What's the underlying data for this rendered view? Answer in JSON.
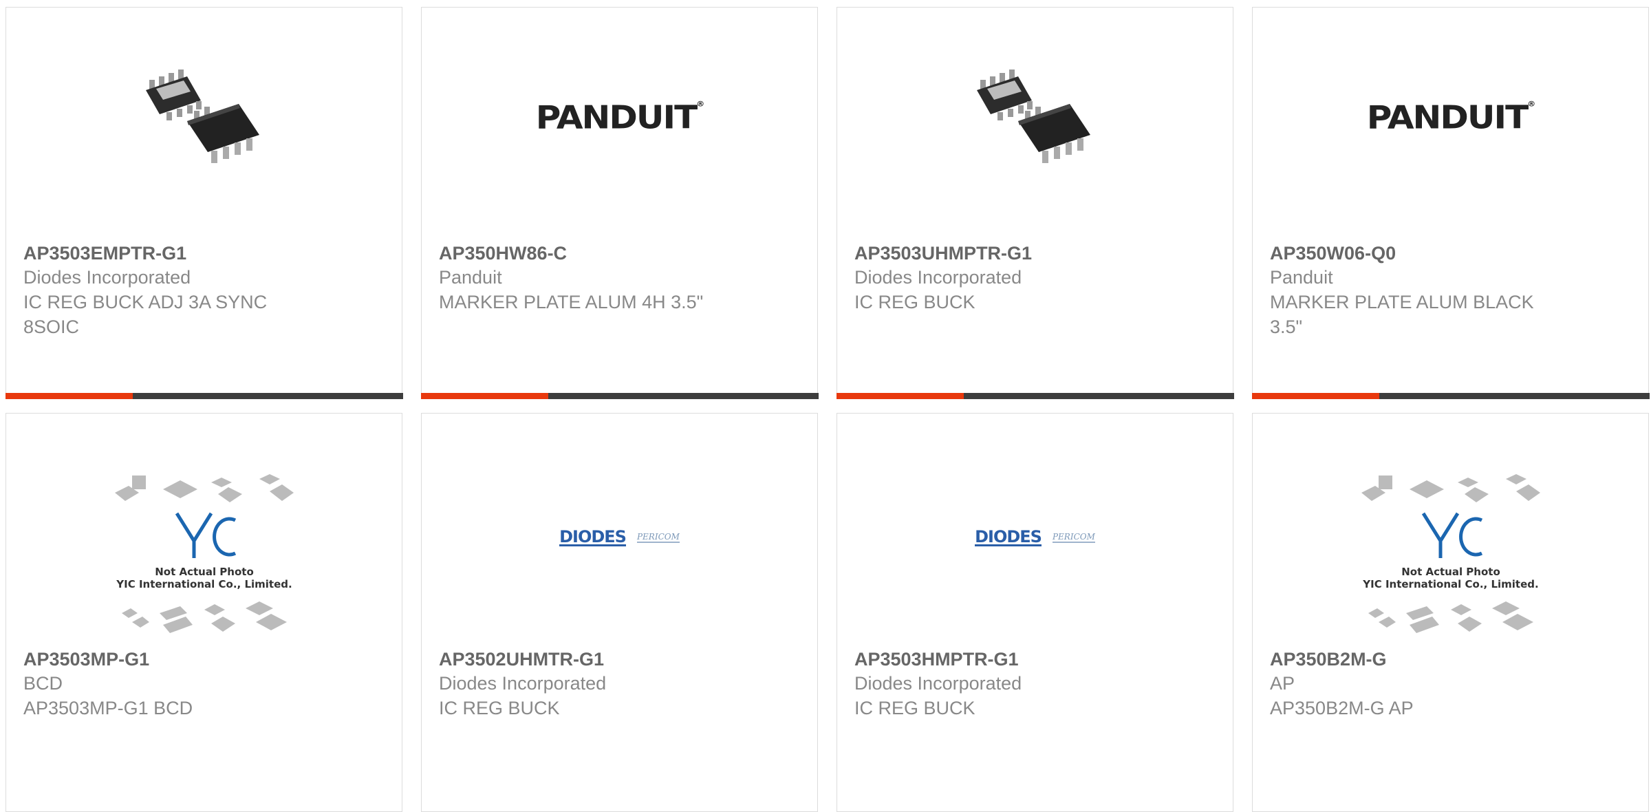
{
  "products": [
    {
      "part_number": "AP3503EMPTR-G1",
      "manufacturer": "Diodes Incorporated",
      "description": "IC REG BUCK ADJ 3A SYNC 8SOIC",
      "image": "soic8-chip-photo"
    },
    {
      "part_number": "AP350HW86-C",
      "manufacturer": "Panduit",
      "description": "MARKER PLATE ALUM 4H 3.5\"",
      "image": "panduit-logo"
    },
    {
      "part_number": "AP3503UHMPTR-G1",
      "manufacturer": "Diodes Incorporated",
      "description": "IC REG BUCK",
      "image": "soic8-chip-photo"
    },
    {
      "part_number": "AP350W06-Q0",
      "manufacturer": "Panduit",
      "description": "MARKER PLATE ALUM BLACK 3.5\"",
      "image": "panduit-logo"
    },
    {
      "part_number": "AP3503MP-G1",
      "manufacturer": "BCD",
      "description": "AP3503MP-G1 BCD",
      "image": "yic-not-actual-photo"
    },
    {
      "part_number": "AP3502UHMTR-G1",
      "manufacturer": "Diodes Incorporated",
      "description": "IC REG BUCK",
      "image": "diodes-pericom-logo"
    },
    {
      "part_number": "AP3503HMPTR-G1",
      "manufacturer": "Diodes Incorporated",
      "description": "IC REG BUCK",
      "image": "diodes-pericom-logo"
    },
    {
      "part_number": "AP350B2M-G",
      "manufacturer": "AP",
      "description": "AP350B2M-G AP",
      "image": "yic-not-actual-photo"
    }
  ],
  "logos": {
    "panduit": "PANDUIT",
    "diodes": "DIODES",
    "pericom": "PERICOM",
    "yic_caption_line1": "Not Actual Photo",
    "yic_caption_line2": "YIC International Co., Limited.",
    "yic": "YIC"
  },
  "colors": {
    "accent": "#e8380d",
    "bar": "#3d3d3d",
    "border": "#dcdcdc",
    "part_number": "#666666",
    "text": "#888888"
  }
}
